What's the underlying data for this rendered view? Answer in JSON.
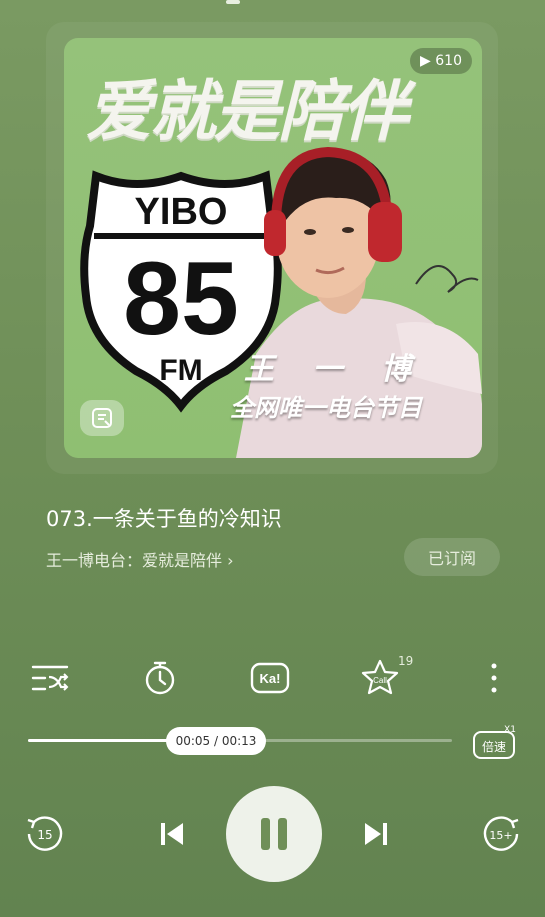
{
  "cover": {
    "title": "爱就是陪伴",
    "play_count": "▶ 610",
    "shield_top": "YIBO",
    "shield_number": "85",
    "shield_bottom": "FM",
    "host_name": "王 一 博",
    "host_desc": "全网唯一电台节目"
  },
  "track": {
    "title": "073.一条关于鱼的冷知识",
    "station": "王一博电台：爱就是陪伴 ›",
    "subscribe_label": "已订阅"
  },
  "controls": {
    "icons": [
      "playlist-shuffle-icon",
      "timer-icon",
      "karaoke-icon",
      "star-call-icon",
      "more-icon"
    ],
    "karaoke_label": "Ka!",
    "call_label": "Call",
    "call_count": "19"
  },
  "progress": {
    "current": "00:05",
    "total": "00:13",
    "time_text": "00:05 / 00:13",
    "fraction": 0.38
  },
  "speed": {
    "label": "倍速",
    "value": "X1"
  },
  "transport": {
    "rewind_label": "15",
    "forward_label": "15+"
  },
  "colors": {
    "background": "#6f8f58",
    "cover_bg": "#8fbf72",
    "headphones": "#c0282e"
  }
}
